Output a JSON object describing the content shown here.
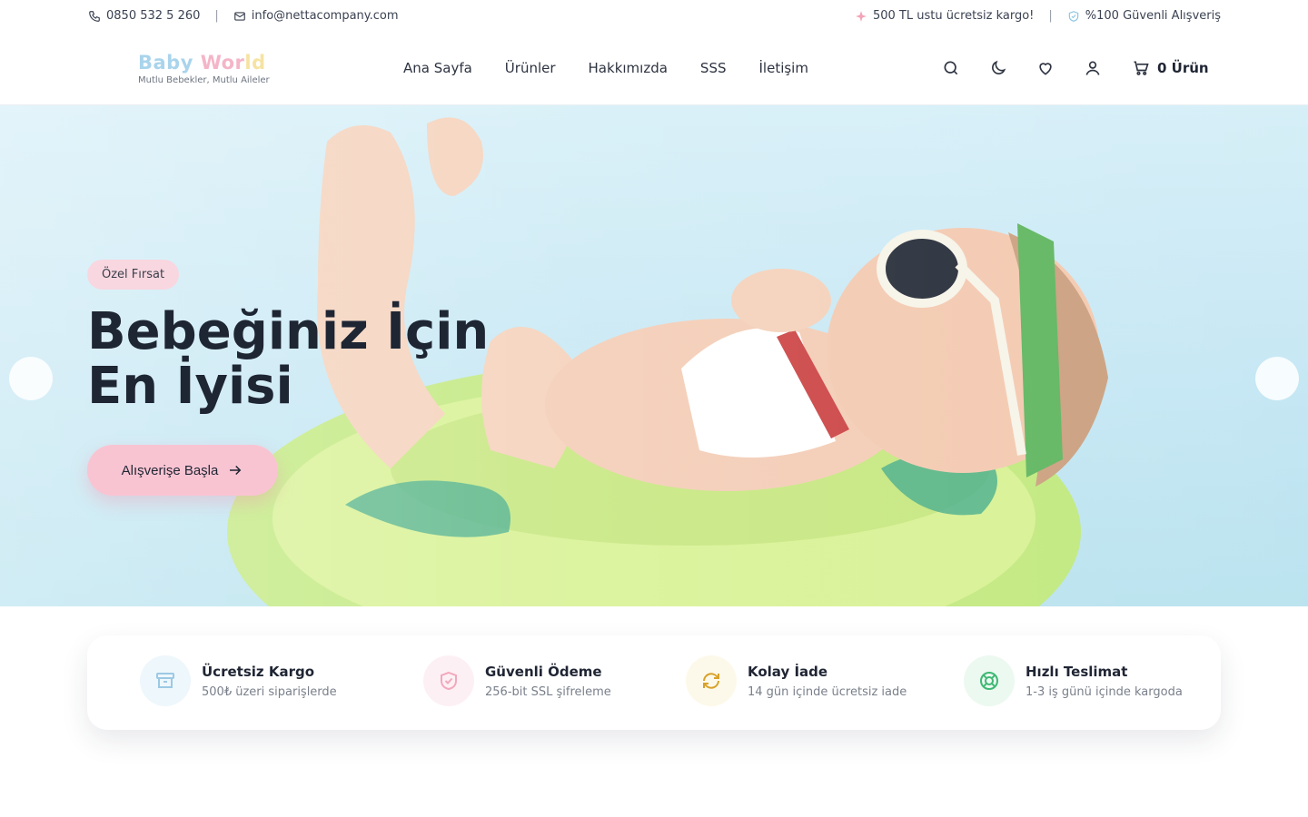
{
  "topbar": {
    "phone": "0850 532 5 260",
    "email": "info@nettacompany.com",
    "shipping": "500 TL ustu ücretsiz kargo!",
    "secure": "%100 Güvenli Alışveriş"
  },
  "header": {
    "logo_part1": "Baby ",
    "logo_part2": "Wor",
    "logo_part3": "ld",
    "tagline": "Mutlu Bebekler, Mutlu Aileler",
    "nav": [
      "Ana Sayfa",
      "Ürünler",
      "Hakkımızda",
      "SSS",
      "İletişim"
    ],
    "cart_label": "0 Ürün"
  },
  "hero": {
    "badge": "Özel Fırsat",
    "title": "Bebeğiniz İçin En İyisi",
    "cta": "Alışverişe Başla"
  },
  "features": [
    {
      "title": "Ücretsiz Kargo",
      "desc": "500₺ üzeri siparişlerde",
      "icon": "archive-box-icon",
      "color": "#eef7fc",
      "stroke": "#9cc9e4"
    },
    {
      "title": "Güvenli Ödeme",
      "desc": "256-bit SSL şifreleme",
      "icon": "shield-check-icon",
      "color": "#fdf0f4",
      "stroke": "#f2a8bd"
    },
    {
      "title": "Kolay İade",
      "desc": "14 gün içinde ücretsiz iade",
      "icon": "refresh-icon",
      "color": "#fdf9ea",
      "stroke": "#d8a22a"
    },
    {
      "title": "Hızlı Teslimat",
      "desc": "1-3 iş günü içinde kargoda",
      "icon": "lifebuoy-icon",
      "color": "#ecf9f1",
      "stroke": "#3fb874"
    }
  ]
}
